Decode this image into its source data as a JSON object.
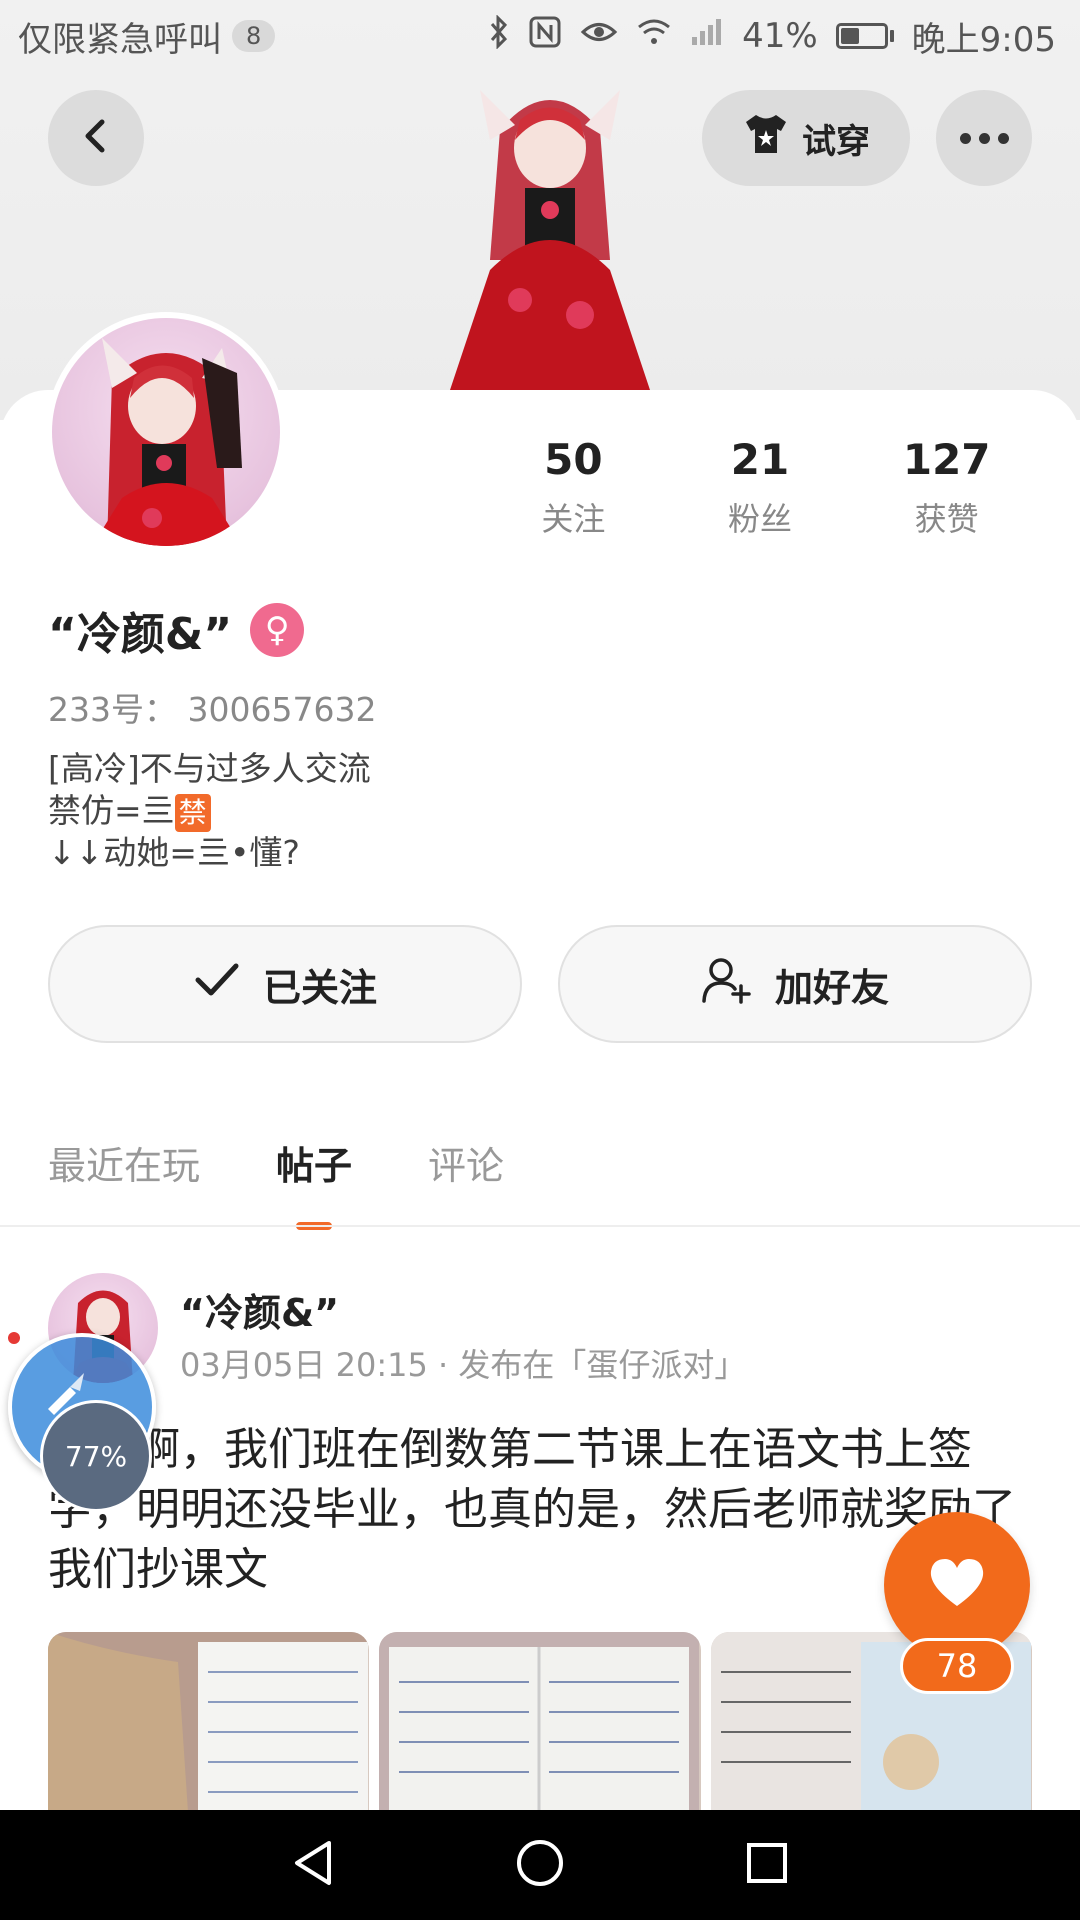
{
  "status_bar": {
    "carrier": "仅限紧急呼叫",
    "notif_count": "8",
    "battery": "41%",
    "battery_level": 0.41,
    "time": "晚上9:05"
  },
  "header": {
    "try_on_label": "试穿"
  },
  "stats": [
    {
      "num": "50",
      "label": "关注"
    },
    {
      "num": "21",
      "label": "粉丝"
    },
    {
      "num": "127",
      "label": "获赞"
    }
  ],
  "profile": {
    "name": "“冷颜&”",
    "gender_symbol": "♀",
    "uid": "233号：  300657632",
    "bio_line1": "[高冷]不与过多人交流",
    "bio_line2_prefix": "禁仿=亖",
    "bio_line2_badge": "禁",
    "bio_line3": "↓↓动她=亖•懂?"
  },
  "actions": {
    "follow_label": "已关注",
    "friend_label": "加好友"
  },
  "tabs": [
    {
      "label": "最近在玩",
      "active": false
    },
    {
      "label": "帖子",
      "active": true
    },
    {
      "label": "评论",
      "active": false
    }
  ],
  "post": {
    "author": "“冷颜&”",
    "meta": "03月05日 20:15 · 发布在「蛋仔派对」",
    "text": "谁懂啊，我们班在倒数第二节课上在语文书上签字，明明还没毕业，也真的是，然后老师就奖励了我们抄课文",
    "likes": "78"
  },
  "progress_bubble": {
    "value": "77%"
  },
  "colors": {
    "accent": "#f26a1b",
    "gender": "#f06a8f"
  }
}
